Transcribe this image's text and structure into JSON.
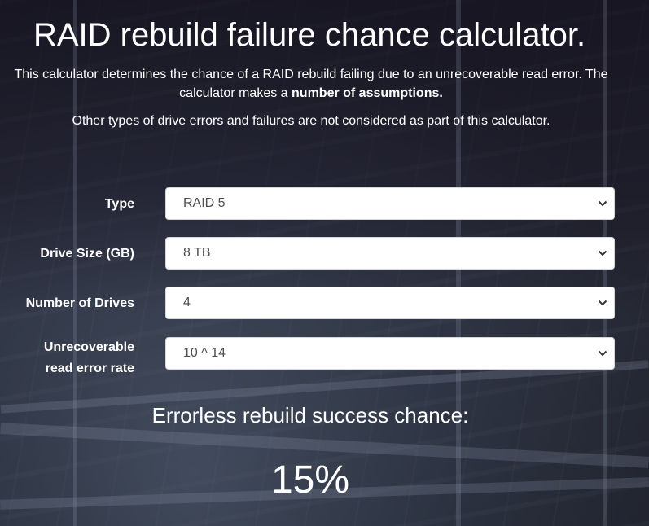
{
  "header": {
    "title": "RAID rebuild failure chance calculator."
  },
  "intro": {
    "text_before": "This calculator determines the chance of a RAID rebuild failing due to an unrecoverable read error. The calculator makes a ",
    "assumptions_link": "number of assumptions.",
    "note": "Other types of drive errors and failures are not considered as part of this calculator."
  },
  "form": {
    "type": {
      "label": "Type",
      "value": "RAID 5"
    },
    "drive_size": {
      "label": "Drive Size (GB)",
      "value": "8 TB"
    },
    "num_drives": {
      "label": "Number of Drives",
      "value": "4"
    },
    "ure": {
      "label_line1": "Unrecoverable",
      "label_line2": "read error rate",
      "value": "10 ^ 14"
    }
  },
  "result": {
    "label": "Errorless rebuild success chance:",
    "value": "15%"
  },
  "colors": {
    "text": "#ffffff",
    "select_bg": "#ffffff",
    "select_text": "#4d4d4d"
  },
  "icons": {
    "select_arrow": "chevron-down-icon"
  }
}
